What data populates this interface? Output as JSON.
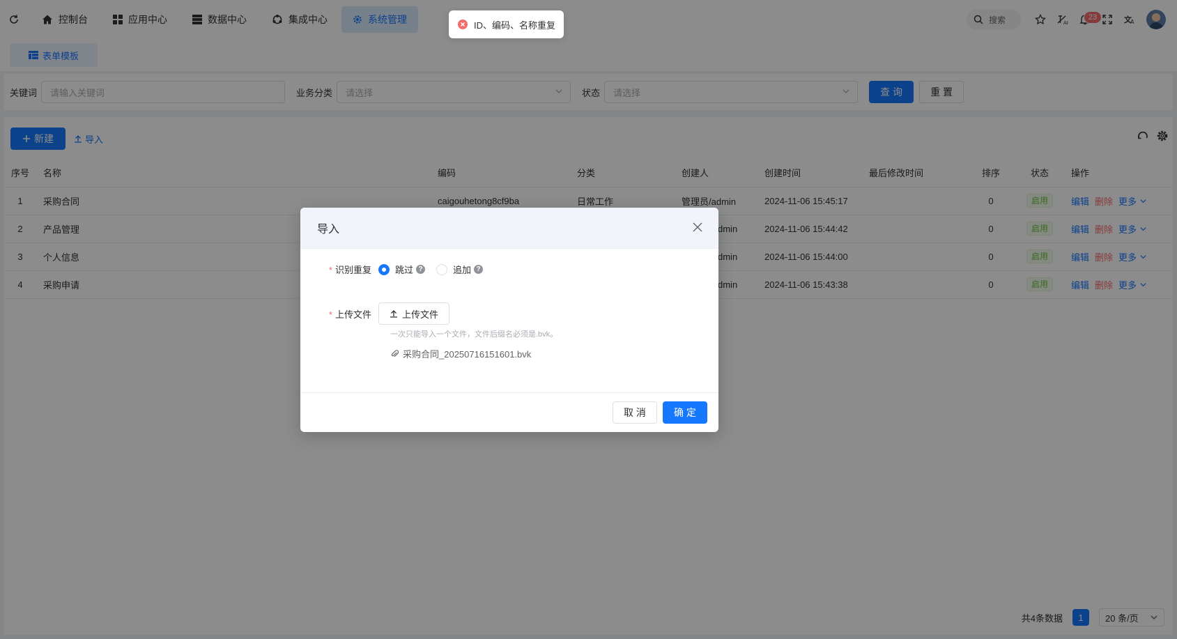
{
  "nav": {
    "items": [
      {
        "label": "控制台",
        "icon": "home-icon"
      },
      {
        "label": "应用中心",
        "icon": "grid-icon"
      },
      {
        "label": "数据中心",
        "icon": "database-icon"
      },
      {
        "label": "集成中心",
        "icon": "integration-icon"
      },
      {
        "label": "系统管理",
        "icon": "gear-icon",
        "active": true
      }
    ],
    "search_label": "搜索",
    "notification_count": "23"
  },
  "tabs": [
    {
      "label": "表单模板",
      "icon": "form-icon"
    }
  ],
  "filter": {
    "keyword_label": "关键词",
    "keyword_placeholder": "请输入关键词",
    "category_label": "业务分类",
    "category_placeholder": "请选择",
    "status_label": "状态",
    "status_placeholder": "请选择",
    "query_button": "查 询",
    "reset_button": "重 置"
  },
  "toolbar": {
    "new_button": "新建",
    "import_link": "导入"
  },
  "table": {
    "columns": [
      "序号",
      "名称",
      "编码",
      "分类",
      "创建人",
      "创建时间",
      "最后修改时间",
      "排序",
      "状态",
      "操作"
    ],
    "rows": [
      {
        "index": "1",
        "name": "采购合同",
        "code": "caigouhetong8cf9ba",
        "category": "日常工作",
        "creator": "管理员/admin",
        "created": "2024-11-06 15:45:17",
        "modified": "",
        "order": "0",
        "status": "启用"
      },
      {
        "index": "2",
        "name": "产品管理",
        "code": "",
        "category": "",
        "creator": "dmin",
        "created": "2024-11-06 15:44:42",
        "modified": "",
        "order": "0",
        "status": "启用"
      },
      {
        "index": "3",
        "name": "个人信息",
        "code": "",
        "category": "",
        "creator": "dmin",
        "created": "2024-11-06 15:44:00",
        "modified": "",
        "order": "0",
        "status": "启用"
      },
      {
        "index": "4",
        "name": "采购申请",
        "code": "",
        "category": "",
        "creator": "dmin",
        "created": "2024-11-06 15:43:38",
        "modified": "",
        "order": "0",
        "status": "启用"
      }
    ],
    "ops": {
      "edit": "编辑",
      "delete": "删除",
      "more": "更多"
    }
  },
  "pager": {
    "total_text": "共4条数据",
    "current_page": "1",
    "page_size": "20 条/页"
  },
  "modal": {
    "title": "导入",
    "dup_label": "识别重复",
    "option_skip": "跳过",
    "option_append": "追加",
    "upload_label": "上传文件",
    "upload_button": "上传文件",
    "hint": "一次只能导入一个文件，文件后缀名必须是.bvk。",
    "file_name": "采购合同_20250716151601.bvk",
    "cancel_button": "取 消",
    "ok_button": "确 定"
  },
  "toast": {
    "message": "ID、编码、名称重复"
  },
  "colors": {
    "primary": "#1677ff",
    "danger": "#f56c6c",
    "success": "#67c23a"
  }
}
